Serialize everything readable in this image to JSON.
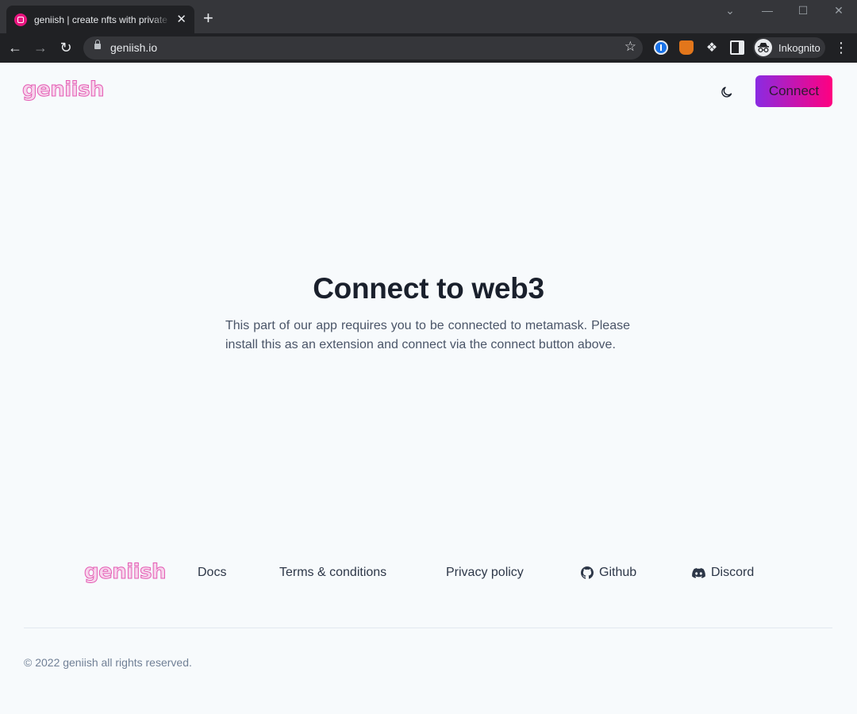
{
  "browser": {
    "tab": {
      "title": "geniish | create nfts with private a",
      "close_glyph": "✕"
    },
    "new_tab_glyph": "+",
    "window_controls": [
      "⌄",
      "—",
      "☐",
      "✕"
    ],
    "nav": {
      "back": "←",
      "forward": "→",
      "reload": "↻"
    },
    "address": {
      "url": "geniish.io",
      "bookmark_glyph": "☆"
    },
    "extensions": [
      "1password-icon",
      "metamask-icon",
      "extensions-puzzle-icon",
      "side-panel-icon"
    ],
    "profile": {
      "label": "Inkognito",
      "icon": "incognito-icon"
    },
    "menu_glyph": "⋮"
  },
  "header": {
    "logo_text": "geniish",
    "connect_label": "Connect",
    "theme_toggle_icon": "moon-icon"
  },
  "main": {
    "title": "Connect to web3",
    "text": "This part of our app requires you to be connected to metamask. Please install this as an extension and connect via the connect button above."
  },
  "footer": {
    "logo_text": "geniish",
    "links": [
      {
        "label": "Docs"
      },
      {
        "label": "Terms & conditions"
      },
      {
        "label": "Privacy policy"
      },
      {
        "label": "Github",
        "icon": "github-icon"
      },
      {
        "label": "Discord",
        "icon": "discord-icon"
      }
    ],
    "copyright": "© 2022 geniish all rights reserved."
  },
  "colors": {
    "page_background": "#f7fafc",
    "button_gradient_start": "#8a2be2",
    "button_gradient_end": "#ff0080",
    "logo_pink": "#e45bb3",
    "title_text": "#1a202c",
    "body_text": "#4a5568"
  }
}
